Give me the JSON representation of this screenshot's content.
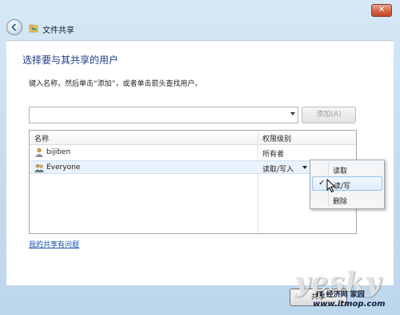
{
  "window": {
    "title": "文件共享",
    "close_label": "✕"
  },
  "main": {
    "heading": "选择要与其共享的用户",
    "instruction": "键入名称，然后单击“添加”，或者单击箭头查找用户。",
    "name_input": {
      "value": "",
      "placeholder": ""
    },
    "add_button": "添加(A)",
    "help_link": "我的共享有问题"
  },
  "table": {
    "columns": [
      "名称",
      "权限级别"
    ],
    "rows": [
      {
        "name": "bijiben",
        "permission": "所有者",
        "icon": "user-icon"
      },
      {
        "name": "Everyone",
        "permission": "读取/写入",
        "icon": "group-icon"
      }
    ]
  },
  "permission_menu": {
    "items": [
      {
        "label": "读取",
        "checked": false
      },
      {
        "label": "读/写",
        "checked": true
      },
      {
        "label": "删除",
        "checked": false
      }
    ]
  },
  "footer": {
    "share_button": "共享"
  },
  "watermark": {
    "logo": "yesky",
    "line1": "IT 经济网 家园",
    "line2": "www.itmop.com"
  }
}
